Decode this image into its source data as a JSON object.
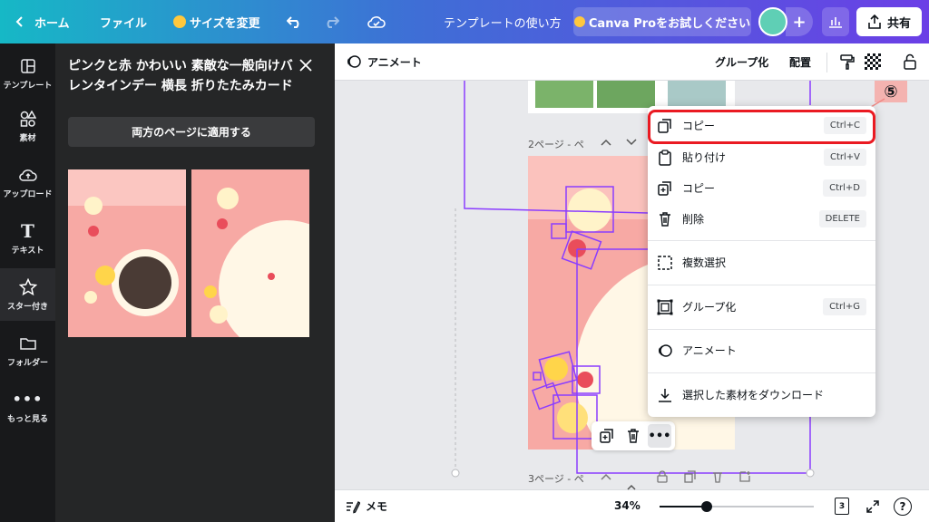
{
  "topbar": {
    "home": "ホーム",
    "file": "ファイル",
    "resize": "サイズを変更",
    "doc_title": "テンプレートの使い方",
    "try_pro": "Canva Proをお試しください",
    "share": "共有"
  },
  "leftrail": {
    "items": [
      {
        "label": "テンプレート",
        "icon": "template-icon"
      },
      {
        "label": "素材",
        "icon": "elements-icon"
      },
      {
        "label": "アップロード",
        "icon": "upload-icon"
      },
      {
        "label": "テキスト",
        "icon": "text-icon"
      },
      {
        "label": "スター付き",
        "icon": "star-icon"
      },
      {
        "label": "フォルダー",
        "icon": "folder-icon"
      },
      {
        "label": "もっと見る",
        "icon": "more-icon"
      }
    ]
  },
  "panel": {
    "title": "ピンクと赤 かわいい 素敵な一般向けバレンタインデー 横長 折りたたみカード",
    "apply_button": "両方のページに適用する"
  },
  "context_toolbar": {
    "animate": "アニメート",
    "group": "グループ化",
    "position": "配置"
  },
  "canvas": {
    "page2_label": "2ページ - ペ",
    "page3_label": "3ページ - ペ"
  },
  "badge": "⑤",
  "context_menu": {
    "items": [
      {
        "label": "コピー",
        "shortcut": "Ctrl+C",
        "icon": "copy-icon"
      },
      {
        "label": "貼り付け",
        "shortcut": "Ctrl+V",
        "icon": "paste-icon"
      },
      {
        "label": "コピー",
        "shortcut": "Ctrl+D",
        "icon": "duplicate-icon"
      },
      {
        "label": "削除",
        "shortcut": "DELETE",
        "icon": "trash-icon"
      },
      {
        "label": "複数選択",
        "shortcut": "",
        "icon": "multi-select-icon"
      },
      {
        "label": "グループ化",
        "shortcut": "Ctrl+G",
        "icon": "group-icon"
      },
      {
        "label": "アニメート",
        "shortcut": "",
        "icon": "animate-icon"
      },
      {
        "label": "選択した素材をダウンロード",
        "shortcut": "",
        "icon": "download-icon"
      }
    ]
  },
  "bottombar": {
    "notes": "メモ",
    "zoom": "34%",
    "page_count": "3"
  },
  "colors": {
    "accent_red": "#ea1a22",
    "selection": "#8b3dff",
    "card_pink": "#f7a9a4"
  }
}
